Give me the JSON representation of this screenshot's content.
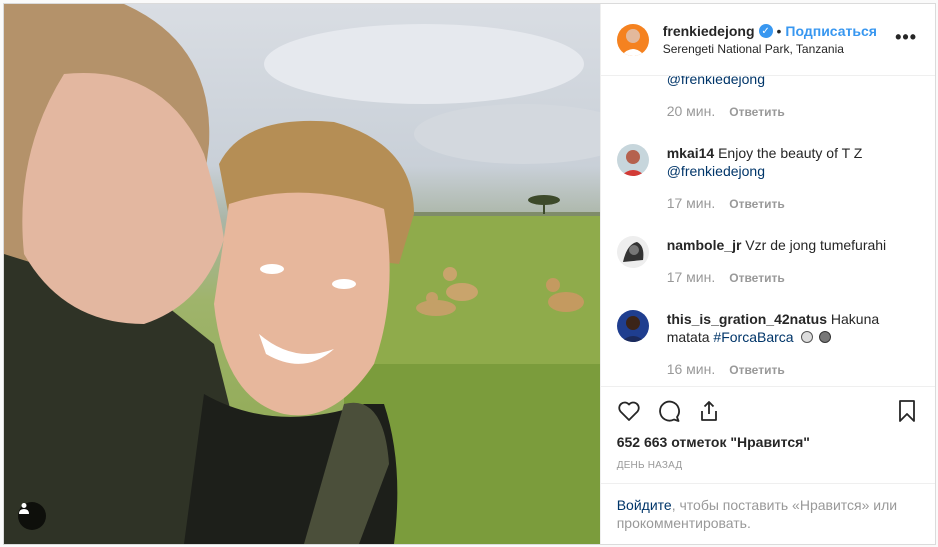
{
  "header": {
    "username": "frenkiedejong",
    "verified_icon": "verified-badge-icon",
    "dot": "•",
    "follow_label": "Подписаться",
    "location": "Serengeti National Park, Tanzania",
    "more_label": "•••"
  },
  "comments": [
    {
      "text_partial": "@frenkiedejong",
      "time": "20 мин.",
      "reply": "Ответить"
    },
    {
      "user": "mkai14",
      "text": " Enjoy the beauty of T Z ",
      "mention": "@frenkiedejong",
      "time": "17 мин.",
      "reply": "Ответить"
    },
    {
      "user": "nambole_jr",
      "text": " Vzr de jong tumefurahi",
      "time": "17 мин.",
      "reply": "Ответить"
    },
    {
      "user": "this_is_gration_42natus",
      "text": " Hakuna matata ",
      "hashtag": "#ForcaBarca",
      "time": "16 мин.",
      "reply": "Ответить"
    }
  ],
  "actions": {
    "like_icon": "heart-icon",
    "comment_icon": "comment-icon",
    "share_icon": "share-icon",
    "save_icon": "bookmark-icon"
  },
  "likes": "652 663 отметок \"Нравится\"",
  "posted_ago": "ДЕНЬ НАЗАД",
  "login": {
    "link": "Войдите",
    "rest": ", чтобы поставить «Нравится» или прокомментировать."
  },
  "colors": {
    "accent": "#3897f0",
    "mention": "#003569",
    "muted": "#999999"
  }
}
